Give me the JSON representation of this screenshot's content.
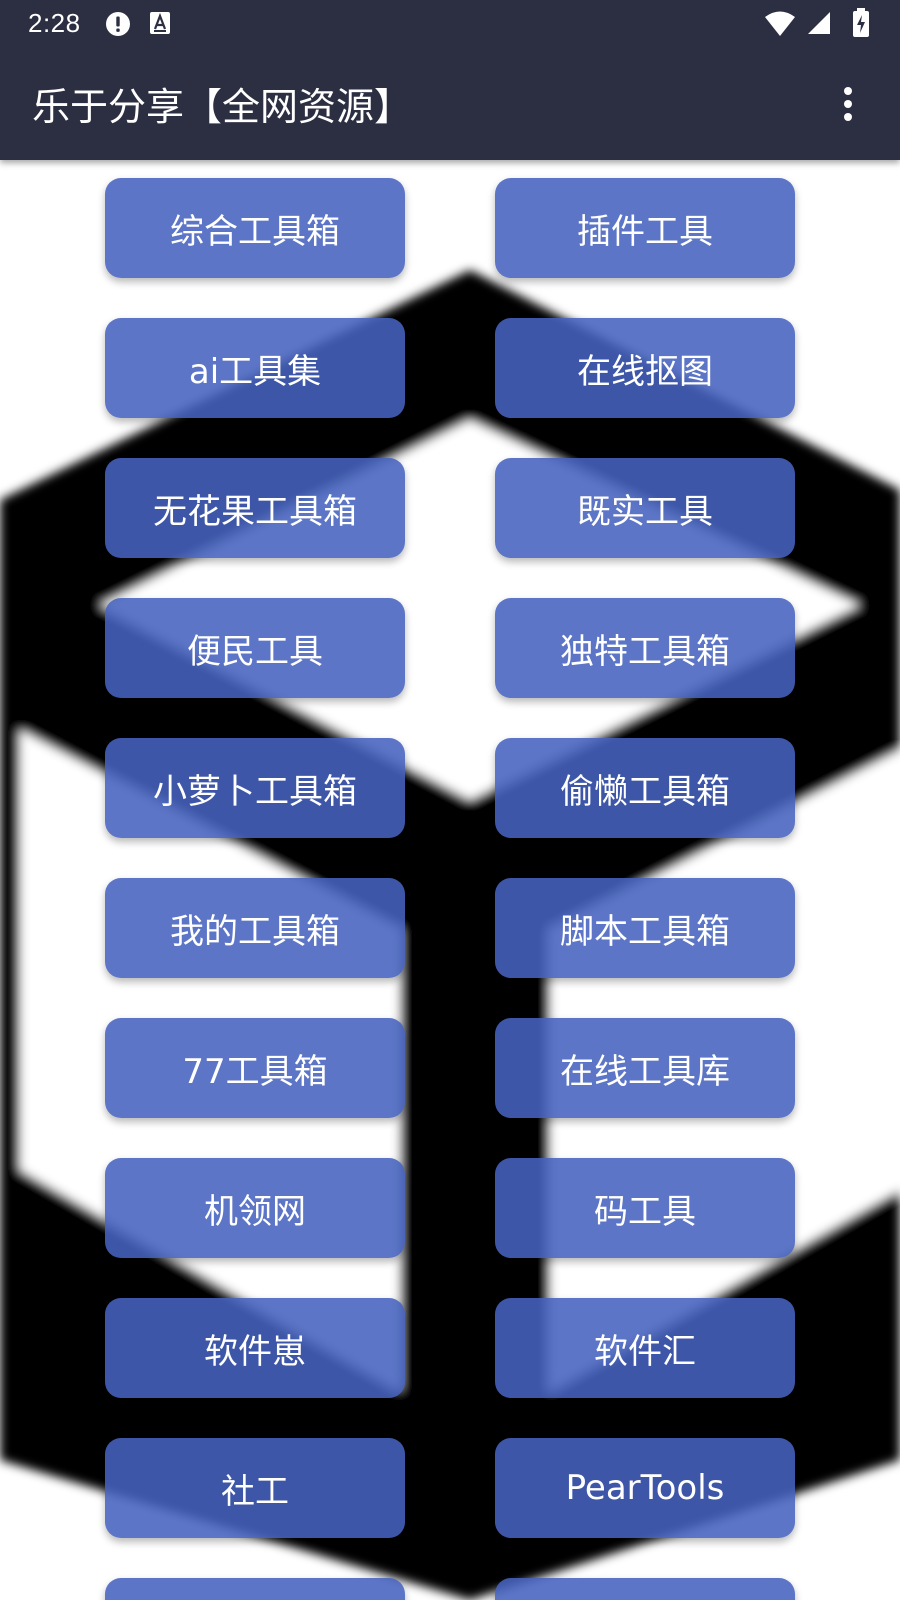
{
  "status_bar": {
    "time": "2:28",
    "icons": [
      "alert-icon",
      "keyboard-a-icon",
      "wifi-icon",
      "signal-icon",
      "battery-charging-icon"
    ]
  },
  "app_bar": {
    "title": "乐于分享【全网资源】",
    "menu_icon": "more-vertical-icon"
  },
  "colors": {
    "bar_bg": "#2c2e42",
    "button_bg": "#4662be",
    "button_text": "#ffffff"
  },
  "tools": {
    "items": [
      {
        "label": "综合工具箱"
      },
      {
        "label": "插件工具"
      },
      {
        "label": "ai工具集"
      },
      {
        "label": "在线抠图"
      },
      {
        "label": "无花果工具箱"
      },
      {
        "label": "既实工具"
      },
      {
        "label": "便民工具"
      },
      {
        "label": "独特工具箱"
      },
      {
        "label": "小萝卜工具箱"
      },
      {
        "label": "偷懒工具箱"
      },
      {
        "label": "我的工具箱"
      },
      {
        "label": "脚本工具箱"
      },
      {
        "label": "77工具箱"
      },
      {
        "label": "在线工具库"
      },
      {
        "label": "机领网"
      },
      {
        "label": "码工具"
      },
      {
        "label": "软件崽"
      },
      {
        "label": "软件汇"
      },
      {
        "label": "社工"
      },
      {
        "label": "PearTools"
      },
      {
        "label": ""
      },
      {
        "label": ""
      }
    ]
  }
}
